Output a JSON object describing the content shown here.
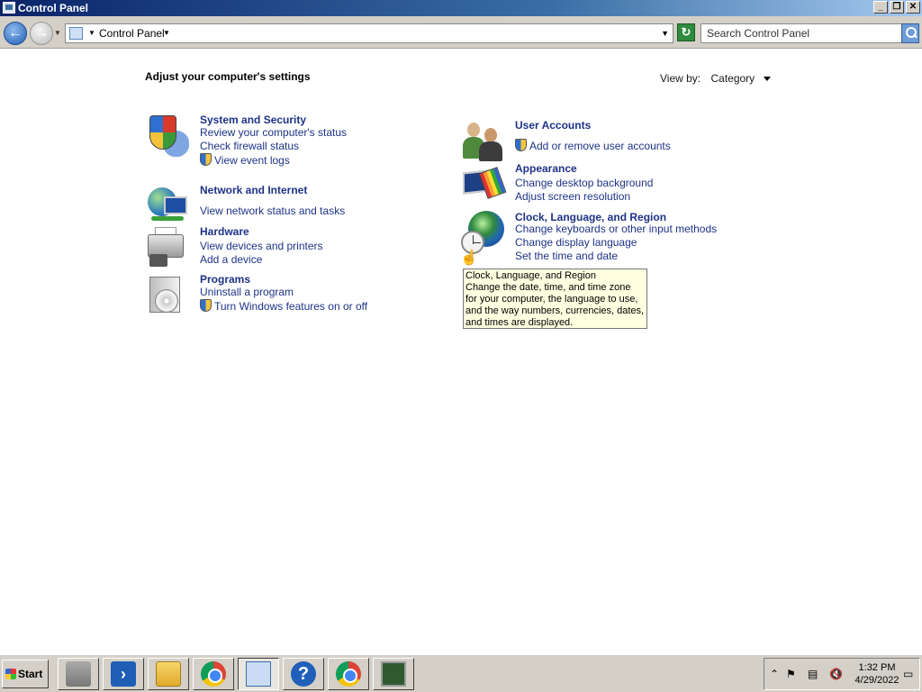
{
  "window": {
    "title": "Control Panel",
    "buttons": {
      "minimize": "_",
      "restore": "❐",
      "close": "✕"
    }
  },
  "navbar": {
    "back_glyph": "←",
    "forward_glyph": "→",
    "breadcrumb": "Control Panel",
    "search_placeholder": "Search Control Panel",
    "refresh_glyph": "↻"
  },
  "content": {
    "heading": "Adjust your computer's settings",
    "view_by_label": "View by:",
    "view_by_value": "Category"
  },
  "categories": {
    "security": {
      "title": "System and Security",
      "links": [
        "Review your computer's status",
        "Check firewall status",
        "View event logs"
      ]
    },
    "network": {
      "title": "Network and Internet",
      "links": [
        "View network status and tasks"
      ]
    },
    "hardware": {
      "title": "Hardware",
      "links": [
        "View devices and printers",
        "Add a device"
      ]
    },
    "programs": {
      "title": "Programs",
      "links": [
        "Uninstall a program",
        "Turn Windows features on or off"
      ]
    },
    "users": {
      "title": "User Accounts",
      "links": [
        "Add or remove user accounts"
      ]
    },
    "appearance": {
      "title": "Appearance",
      "links": [
        "Change desktop background",
        "Adjust screen resolution"
      ]
    },
    "clock": {
      "title": "Clock, Language, and Region",
      "links": [
        "Change keyboards or other input methods",
        "Change display language",
        "Set the time and date"
      ]
    }
  },
  "tooltip": {
    "title": "Clock, Language, and Region",
    "body": "Change the date, time, and time zone for your computer, the language to use, and the way numbers, currencies, dates, and times are displayed."
  },
  "taskbar": {
    "start_label": "Start",
    "clock_time": "1:32 PM",
    "clock_date": "4/29/2022"
  },
  "colors": {
    "link": "#1e3287",
    "tooltip_bg": "#ffffe1",
    "chrome": "#d4d0c8"
  }
}
